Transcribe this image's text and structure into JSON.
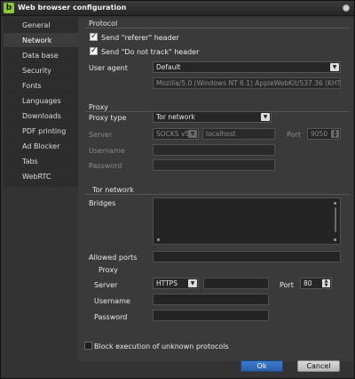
{
  "window": {
    "title": "Web browser configuration",
    "app_icon": "b"
  },
  "sidebar": {
    "items": [
      {
        "label": "General"
      },
      {
        "label": "Network"
      },
      {
        "label": "Data base"
      },
      {
        "label": "Security"
      },
      {
        "label": "Fonts"
      },
      {
        "label": "Languages"
      },
      {
        "label": "Downloads"
      },
      {
        "label": "PDF printing"
      },
      {
        "label": "Ad Blocker"
      },
      {
        "label": "Tabs"
      },
      {
        "label": "WebRTC"
      }
    ],
    "active": "Network"
  },
  "protocol": {
    "legend": "Protocol",
    "send_referer": {
      "label": "Send \"referer\" header",
      "checked": true
    },
    "send_dnt": {
      "label": "Send \"Do not track\" header",
      "checked": true
    },
    "user_agent_label": "User agent",
    "user_agent_value": "Default",
    "user_agent_string": "Mozilla/5.0 (Windows NT 6.1) AppleWebKit/537.36 (KHTML, like Ge"
  },
  "proxy": {
    "legend": "Proxy",
    "type_label": "Proxy type",
    "type_value": "Tor network",
    "server_label": "Server",
    "server_protocol": "SOCKS v5",
    "server_host": "localhost",
    "port_label": "Port",
    "port_value": "9050",
    "username_label": "Username",
    "password_label": "Password"
  },
  "tor": {
    "legend": "Tor network",
    "bridges_label": "Bridges",
    "allowed_ports_label": "Allowed ports",
    "allowed_ports_value": "",
    "proxy_legend": "Proxy",
    "server_label": "Server",
    "server_protocol": "HTTPS",
    "server_host": "",
    "port_label": "Port",
    "port_value": "80",
    "username_label": "Username",
    "password_label": "Password"
  },
  "block_unknown": {
    "label": "Block execution of unknown protocols",
    "checked": false
  },
  "buttons": {
    "ok": "Ok",
    "cancel": "Cancel"
  },
  "colors": {
    "accent": "#2b5fa8",
    "brand": "#8cc63f"
  }
}
